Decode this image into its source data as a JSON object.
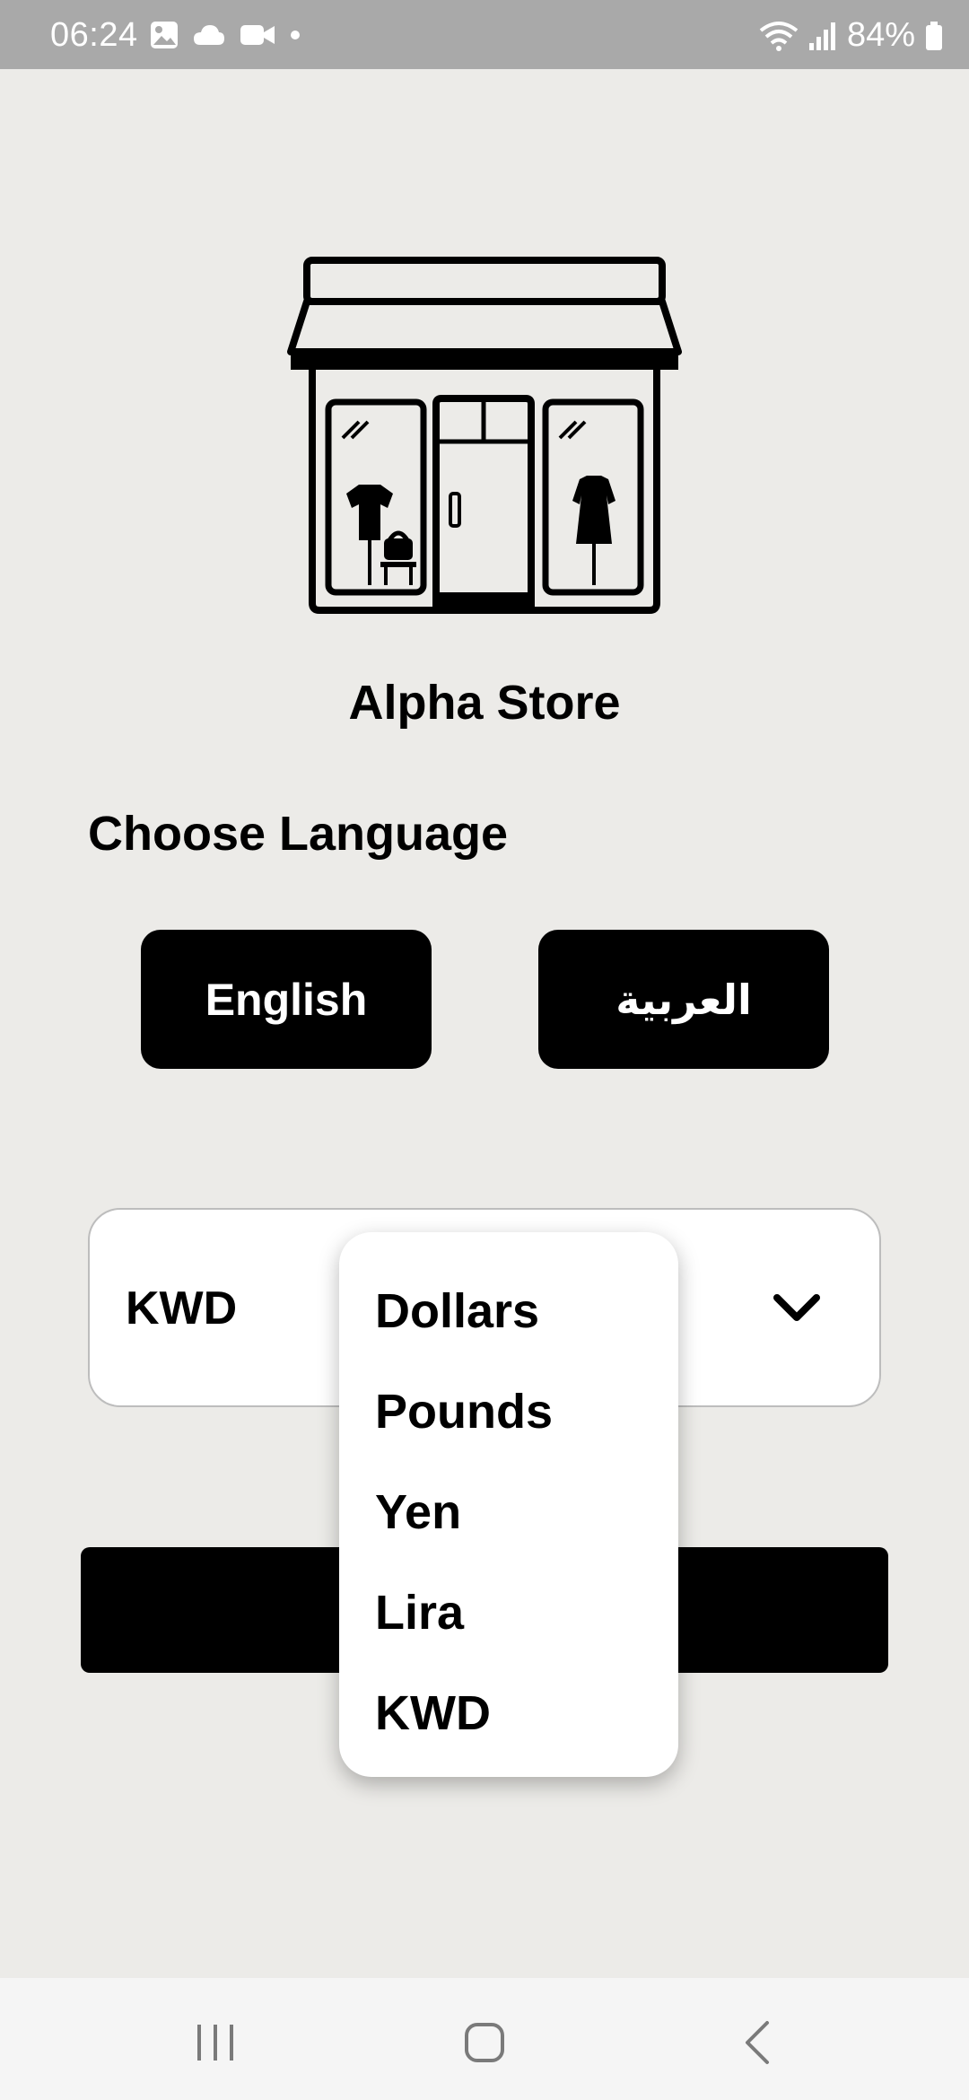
{
  "status_bar": {
    "time": "06:24",
    "battery": "84%",
    "left_icons": [
      "gallery-icon",
      "cloud-icon",
      "video-icon",
      "dot-icon"
    ],
    "right_icons": [
      "wifi-icon",
      "signal-icon",
      "battery-icon"
    ]
  },
  "app": {
    "title": "Alpha Store",
    "illustration": "store-front-icon"
  },
  "language": {
    "label": "Choose Language",
    "english_label": "English",
    "arabic_label": "العربية"
  },
  "currency": {
    "selected": "KWD",
    "options": [
      "Dollars",
      "Pounds",
      "Yen",
      "Lira",
      "KWD"
    ]
  },
  "nav": {
    "icons": [
      "recent-apps-icon",
      "home-icon",
      "back-icon"
    ]
  },
  "colors": {
    "background": "#ecebe8",
    "status_bar": "#a9a9a9",
    "button": "#000000",
    "card": "#ffffff"
  }
}
